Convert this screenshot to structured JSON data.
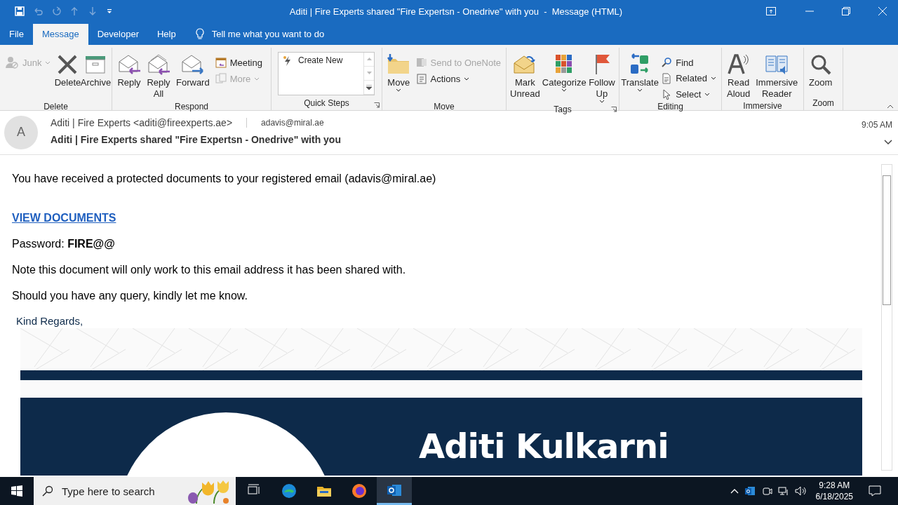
{
  "window": {
    "title": "Aditi | Fire Experts shared \"Fire Expertsn - Onedrive\" with you  -  Message (HTML)"
  },
  "menu_tabs": [
    {
      "label": "File",
      "selected": false
    },
    {
      "label": "Message",
      "selected": true
    },
    {
      "label": "Developer",
      "selected": false
    },
    {
      "label": "Help",
      "selected": false
    }
  ],
  "tell_me": {
    "placeholder": "Tell me what you want to do"
  },
  "ribbon_groups": [
    {
      "label": "Delete",
      "launcher": false,
      "items": [
        {
          "kind": "stack",
          "items": [
            {
              "label": "Junk",
              "disabled": true,
              "dropdown": true
            }
          ]
        },
        {
          "kind": "large",
          "label": "Delete",
          "disabled": false,
          "dropdown": false
        },
        {
          "kind": "large",
          "label": "Archive",
          "disabled": false,
          "dropdown": false
        }
      ]
    },
    {
      "label": "Respond",
      "launcher": false,
      "items": [
        {
          "kind": "large",
          "label": "Reply",
          "disabled": false,
          "dropdown": false
        },
        {
          "kind": "large",
          "label": "Reply All",
          "disabled": false,
          "dropdown": false
        },
        {
          "kind": "large",
          "label": "Forward",
          "disabled": false,
          "dropdown": false
        },
        {
          "kind": "stack",
          "items": [
            {
              "label": "Meeting",
              "disabled": false,
              "dropdown": false
            },
            {
              "label": "More",
              "disabled": true,
              "dropdown": true
            }
          ]
        }
      ]
    },
    {
      "label": "Quick Steps",
      "launcher": true,
      "items": [
        {
          "kind": "gallery",
          "label": "Create New"
        }
      ]
    },
    {
      "label": "Move",
      "launcher": false,
      "items": [
        {
          "kind": "large",
          "label": "Move",
          "disabled": false,
          "dropdown": true
        },
        {
          "kind": "stack",
          "items": [
            {
              "label": "Send to OneNote",
              "disabled": true,
              "dropdown": false
            },
            {
              "label": "Actions",
              "disabled": false,
              "dropdown": true
            }
          ]
        }
      ]
    },
    {
      "label": "Tags",
      "launcher": true,
      "items": [
        {
          "kind": "large",
          "label": "Mark Unread",
          "disabled": false,
          "dropdown": false
        },
        {
          "kind": "large",
          "label": "Categorize",
          "disabled": false,
          "dropdown": true
        },
        {
          "kind": "large",
          "label": "Follow Up",
          "disabled": false,
          "dropdown": true
        }
      ]
    },
    {
      "label": "Editing",
      "launcher": false,
      "items": [
        {
          "kind": "large",
          "label": "Translate",
          "disabled": false,
          "dropdown": true
        },
        {
          "kind": "stack",
          "items": [
            {
              "label": "Find",
              "disabled": false,
              "dropdown": false
            },
            {
              "label": "Related",
              "disabled": false,
              "dropdown": true
            },
            {
              "label": "Select",
              "disabled": false,
              "dropdown": true
            }
          ]
        }
      ]
    },
    {
      "label": "Immersive",
      "launcher": false,
      "items": [
        {
          "kind": "large",
          "label": "Read Aloud",
          "disabled": false,
          "dropdown": false
        },
        {
          "kind": "large",
          "label": "Immersive Reader",
          "disabled": false,
          "dropdown": false
        }
      ]
    },
    {
      "label": "Zoom",
      "launcher": false,
      "items": [
        {
          "kind": "large",
          "label": "Zoom",
          "disabled": false,
          "dropdown": false
        }
      ]
    }
  ],
  "message_header": {
    "avatar": "A",
    "from": "Aditi | Fire Experts <aditi@fireexperts.ae>",
    "to": "adavis@miral.ae",
    "subject": "Aditi | Fire Experts shared \"Fire Expertsn - Onedrive\" with you",
    "time": "9:05 AM"
  },
  "message_body": {
    "paragraphs": [
      {
        "kind": "text",
        "text": "You have received a protected documents to your registered email (adavis@miral.ae)"
      },
      {
        "kind": "link",
        "text": "VIEW DOCUMENTS"
      },
      {
        "kind": "text",
        "text": "Password: **FIRE@@**"
      },
      {
        "kind": "text",
        "text": "Note this document will only work to this email address it has been shared with."
      },
      {
        "kind": "text",
        "text": "Should you have any query, kindly let me know."
      },
      {
        "kind": "closing",
        "text": "Kind Regards,"
      }
    ],
    "signature_banner": {
      "name": "Aditi Kulkarni"
    }
  },
  "taskbar": {
    "search": {
      "placeholder": "Type here to search"
    },
    "apps": [
      {
        "selected": false
      },
      {
        "selected": false
      },
      {
        "selected": false
      },
      {
        "selected": false
      },
      {
        "selected": true
      }
    ],
    "time": "9:28 AM",
    "date": "6/18/2025"
  }
}
